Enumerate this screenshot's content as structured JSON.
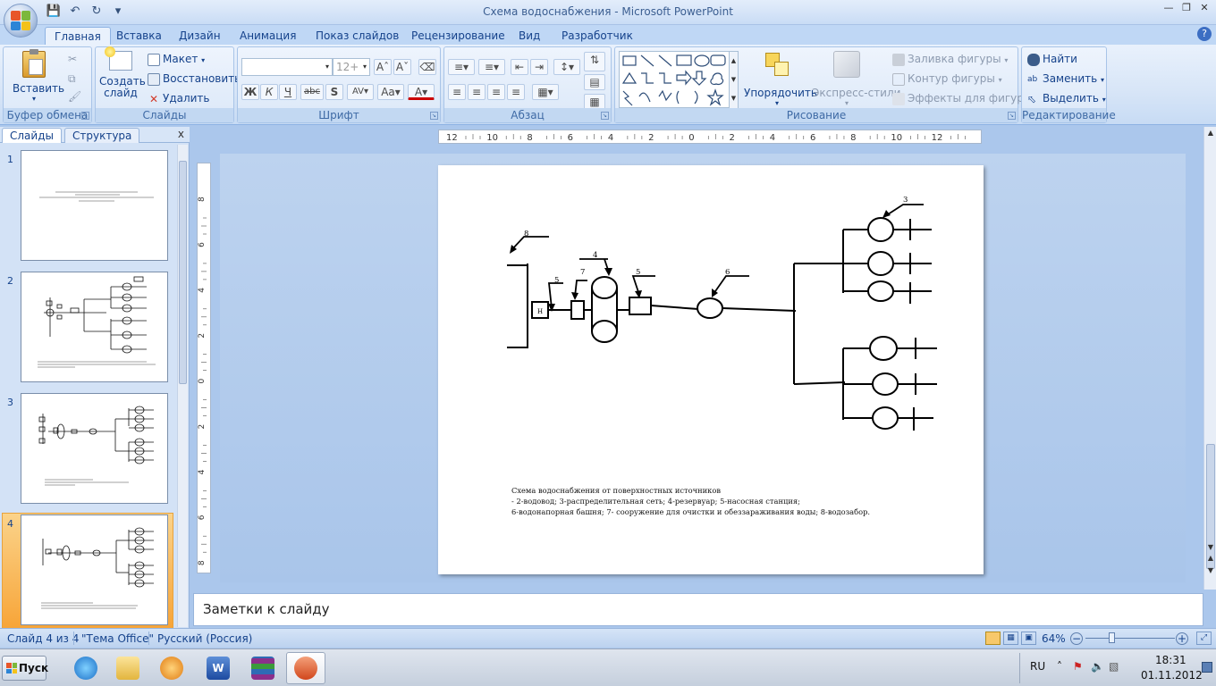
{
  "window": {
    "title": "Схема водоснабжения - Microsoft PowerPoint"
  },
  "ribbon_tabs": [
    "Главная",
    "Вставка",
    "Дизайн",
    "Анимация",
    "Показ слайдов",
    "Рецензирование",
    "Вид",
    "Разработчик"
  ],
  "ribbon": {
    "clipboard": {
      "paste": "Вставить",
      "group": "Буфер обмена"
    },
    "slides": {
      "new_slide": "Создать слайд",
      "layout": "Макет",
      "reset": "Восстановить",
      "delete": "Удалить",
      "group": "Слайды"
    },
    "font": {
      "size": "12+",
      "group": "Шрифт"
    },
    "paragraph": {
      "group": "Абзац"
    },
    "drawing": {
      "arrange": "Упорядочить",
      "quick_styles": "Экспресс-стили",
      "fill": "Заливка фигуры",
      "outline": "Контур фигуры",
      "effects": "Эффекты для фигур",
      "group": "Рисование"
    },
    "editing": {
      "find": "Найти",
      "replace": "Заменить",
      "select": "Выделить",
      "group": "Редактирование"
    }
  },
  "panel": {
    "tab_slides": "Слайды",
    "tab_outline": "Структура",
    "close": "x",
    "slide_numbers": [
      "1",
      "2",
      "3",
      "4"
    ],
    "selected": 4
  },
  "rulers": {
    "horizontal": [
      "12",
      "10",
      "8",
      "6",
      "4",
      "2",
      "0",
      "2",
      "4",
      "6",
      "8",
      "10",
      "12"
    ],
    "vertical": [
      "8",
      "6",
      "4",
      "2",
      "0",
      "2",
      "4",
      "6",
      "8"
    ]
  },
  "slide": {
    "labels": {
      "l3": "3",
      "l8": "8",
      "l4": "4",
      "l7": "7",
      "l5a": "5",
      "l5b": "5",
      "l6": "6",
      "pump": "Н"
    },
    "caption": {
      "line1": "Схема водоснабжения  от поверхностных   источников",
      "line2": "- 2-водовод; 3-распределительная   сеть;  4-резервуар;  5-насосная   станция;",
      "line3": "6-водонапорная  башня;  7- сооружение  для очистки и обеззараживания   воды; 8-водозабор."
    }
  },
  "notes": {
    "placeholder": "Заметки к слайду"
  },
  "statusbar": {
    "slide_info": "Слайд 4 из 4",
    "theme": "\"Тема Office\"",
    "language": "Русский (Россия)",
    "zoom": "64%"
  },
  "taskbar": {
    "start": "Пуск",
    "lang": "RU",
    "time": "18:31",
    "date": "01.11.2012"
  }
}
